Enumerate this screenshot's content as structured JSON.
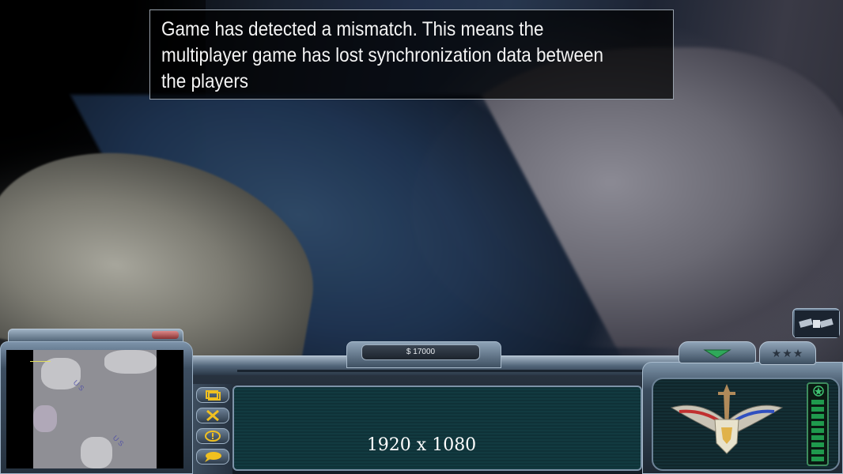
{
  "notification": {
    "lines": [
      "Game has detected a mismatch. This means the",
      " multiplayer game has lost synchronization data between",
      " the players"
    ]
  },
  "hud": {
    "money": "$ 17000",
    "resolution_overlay": "1920 x 1080",
    "minimap_labels": [
      "U S",
      "U S"
    ],
    "rank_stars": "★★★",
    "side_buttons": [
      {
        "name": "build-structures-icon"
      },
      {
        "name": "repair-tools-icon"
      },
      {
        "name": "alert-icon"
      },
      {
        "name": "chat-bubble-icon"
      }
    ]
  },
  "colors": {
    "panel_teal": "#0f3238",
    "frame_steel": "#7d93a8",
    "power_green": "#1f9a4d",
    "money_text": "#e8ecf0"
  }
}
